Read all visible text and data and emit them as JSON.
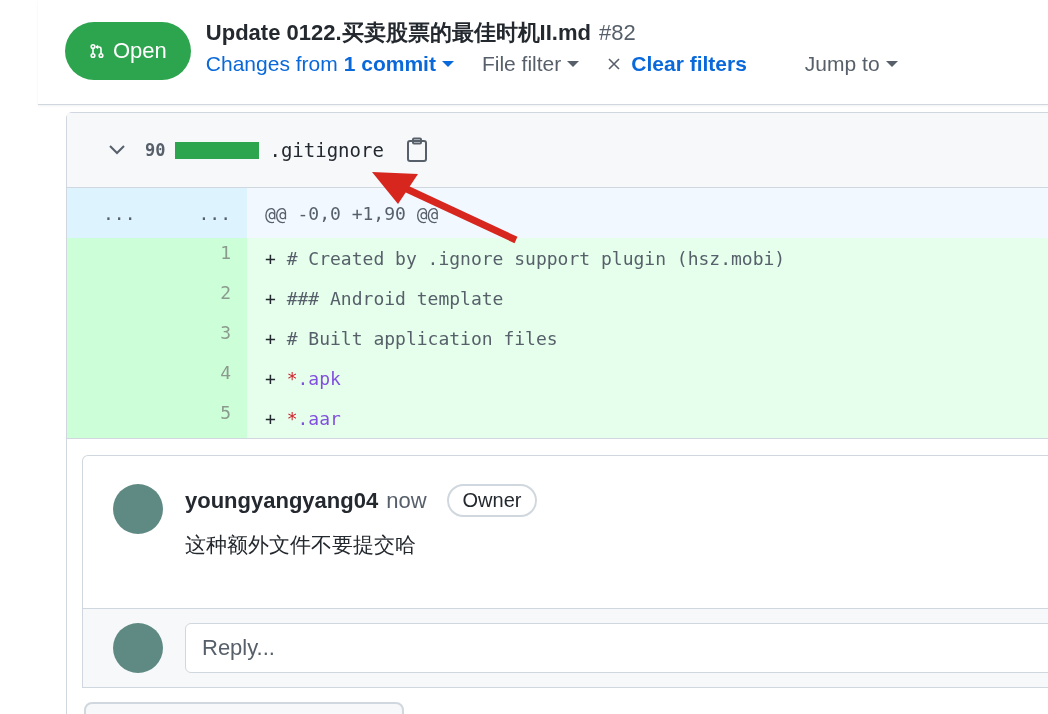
{
  "pr": {
    "state_label": "Open",
    "title": "Update 0122.买卖股票的最佳时机II.md",
    "number": "#82"
  },
  "toolbar": {
    "changes_prefix": "Changes from",
    "changes_link": "1 commit",
    "file_filter": "File filter",
    "clear_filters": "Clear filters",
    "jump_to": "Jump to"
  },
  "file": {
    "expanded": true,
    "additions": "90",
    "name": ".gitignore",
    "level": 1.0,
    "hunk": {
      "old_marker": "...",
      "new_marker": "...",
      "header": "@@ -0,0 +1,90 @@"
    },
    "lines": [
      {
        "number": "1",
        "sign": "+",
        "segments": [
          {
            "kind": "comment",
            "text": "# Created by .ignore support plugin (hsz.mobi)"
          }
        ]
      },
      {
        "number": "2",
        "sign": "+",
        "segments": [
          {
            "kind": "comment",
            "text": "### Android template"
          }
        ]
      },
      {
        "number": "3",
        "sign": "+",
        "segments": [
          {
            "kind": "comment",
            "text": "# Built application files"
          }
        ]
      },
      {
        "number": "4",
        "sign": "+",
        "segments": [
          {
            "kind": "glob",
            "text": "*"
          },
          {
            "kind": "ext",
            "text": ".apk"
          }
        ]
      },
      {
        "number": "5",
        "sign": "+",
        "segments": [
          {
            "kind": "glob",
            "text": "*"
          },
          {
            "kind": "ext",
            "text": ".aar"
          }
        ]
      }
    ]
  },
  "comment": {
    "author": "youngyangyang04",
    "time": "now",
    "badge": "Owner",
    "body": "这种额外文件不要提交哈"
  },
  "reply": {
    "placeholder": "Reply..."
  }
}
